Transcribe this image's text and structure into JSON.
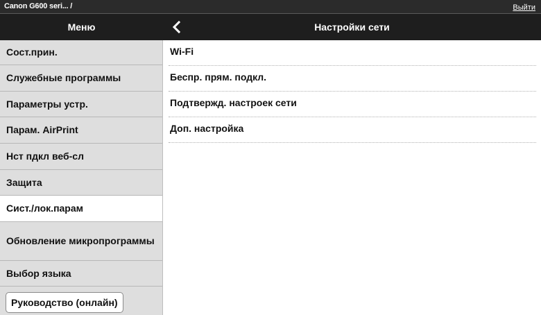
{
  "top_bar": {
    "device": "Canon G600 seri... /",
    "logout": "Выйти"
  },
  "header": {
    "menu_title": "Меню",
    "page_title": "Настройки сети"
  },
  "sidebar": {
    "items": [
      {
        "label": "Сост.прин."
      },
      {
        "label": "Служебные программы"
      },
      {
        "label": "Параметры устр."
      },
      {
        "label": "Парам. AirPrint"
      },
      {
        "label": "Нст пдкл веб-сл"
      },
      {
        "label": "Защита"
      },
      {
        "label": "Сист./лок.парам"
      },
      {
        "label": "Обновление микропрограммы"
      },
      {
        "label": "Выбор языка"
      }
    ],
    "active": "Сист./лок.парам",
    "manual_button": "Руководство (онлайн)"
  },
  "content": {
    "items": [
      {
        "label": "Wi-Fi"
      },
      {
        "label": "Беспр. прям. подкл."
      },
      {
        "label": "Подтвержд. настроек сети"
      },
      {
        "label": "Доп. настройка"
      }
    ]
  },
  "icons": {
    "back": "chevron-left-icon"
  }
}
